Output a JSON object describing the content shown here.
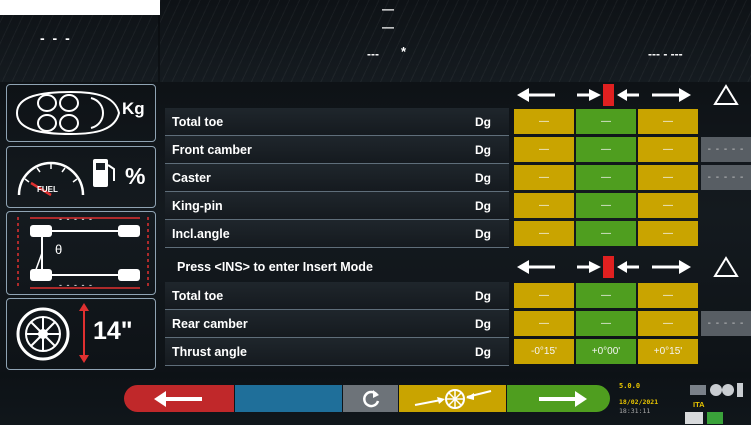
{
  "top": {
    "left_value": "- - -",
    "center_dash_1": "—",
    "center_dash_2": "—",
    "center_dash_3": "---",
    "center_mark": "*",
    "right_value": "--- - ---"
  },
  "sidebar": {
    "load_unit": "Kg",
    "fuel_label": "FUEL",
    "fuel_unit": "%",
    "track_dashes_top": "- - - - -",
    "track_dashes_bottom": "- - - - -",
    "theta_symbol": "θ",
    "rim_size": "14\""
  },
  "front_table": {
    "rows": [
      {
        "label": "Total toe",
        "unit": "Dg",
        "cells": [
          "—",
          "—",
          "—"
        ],
        "extra": ""
      },
      {
        "label": "Front camber",
        "unit": "Dg",
        "cells": [
          "—",
          "—",
          "—"
        ],
        "extra": "- - - - -"
      },
      {
        "label": "Caster",
        "unit": "Dg",
        "cells": [
          "—",
          "—",
          "—"
        ],
        "extra": "- - - - -"
      },
      {
        "label": "King-pin",
        "unit": "Dg",
        "cells": [
          "—",
          "—",
          "—"
        ],
        "extra": ""
      },
      {
        "label": "Incl.angle",
        "unit": "Dg",
        "cells": [
          "—",
          "—",
          "—"
        ],
        "extra": ""
      }
    ]
  },
  "insert_prompt": "Press <INS> to enter Insert Mode",
  "rear_table": {
    "rows": [
      {
        "label": "Total toe",
        "unit": "Dg",
        "cells": [
          "—",
          "—",
          "—"
        ],
        "extra": ""
      },
      {
        "label": "Rear camber",
        "unit": "Dg",
        "cells": [
          "—",
          "—",
          "—"
        ],
        "extra": "- - - - -"
      },
      {
        "label": "Thrust angle",
        "unit": "Dg",
        "cells": [
          "-0°15'",
          "+0°00'",
          "+0°15'"
        ],
        "extra": ""
      }
    ]
  },
  "status": {
    "version": "5.0.0",
    "date": "18/02/2021",
    "time": "18:31:11",
    "language": "ITA"
  },
  "colors": {
    "tolerance_low": "#c9a400",
    "tolerance_ok": "#4f9e1f",
    "back_button": "#c0282a",
    "forward_button": "#4f9e1f",
    "wheel_button": "#c9a400",
    "refresh_button": "#6d7379",
    "blue_slot": "#1f6f9a"
  }
}
